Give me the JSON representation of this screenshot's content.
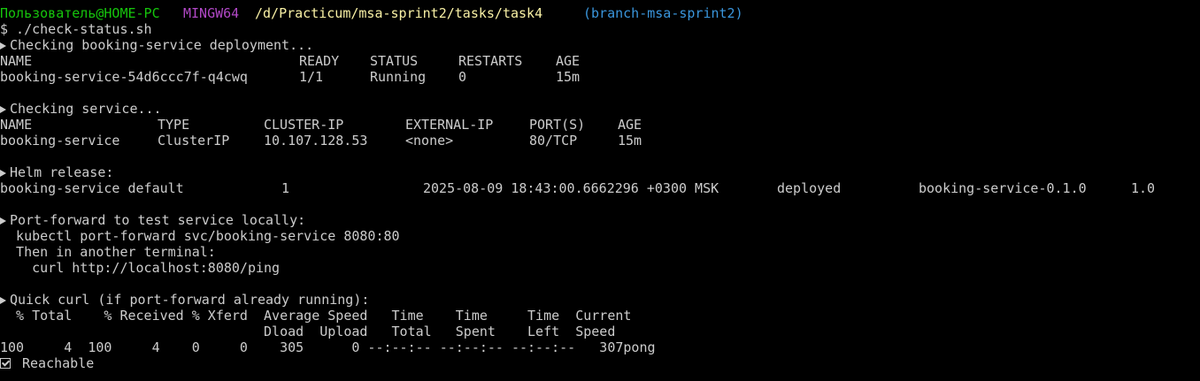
{
  "prompt": {
    "user_host": "Пользователь@HOME-PC",
    "env": "MINGW64",
    "path": "/d/Practicum/msa-sprint2/tasks/task4",
    "branch": "(branch-msa-sprint2)"
  },
  "command": "$ ./check-status.sh",
  "deployment": {
    "heading": "Checking booking-service deployment...",
    "headers": [
      "NAME",
      "READY",
      "STATUS",
      "RESTARTS",
      "AGE"
    ],
    "row": [
      "booking-service-54d6ccc7f-q4cwq",
      "1/1",
      "Running",
      "0",
      "15m"
    ]
  },
  "service": {
    "heading": "Checking service...",
    "headers": [
      "NAME",
      "TYPE",
      "CLUSTER-IP",
      "EXTERNAL-IP",
      "PORT(S)",
      "AGE"
    ],
    "row": [
      "booking-service",
      "ClusterIP",
      "10.107.128.53",
      "<none>",
      "80/TCP",
      "15m"
    ]
  },
  "helm": {
    "heading": "Helm release:",
    "row": [
      "booking-service default",
      "1",
      "2025-08-09 18:43:00.6662296 +0300 MSK",
      "deployed",
      "booking-service-0.1.0",
      "1.0"
    ]
  },
  "port_forward": {
    "heading": "Port-forward to test service locally:",
    "line1": "  kubectl port-forward svc/booking-service 8080:80",
    "line2": "  Then in another terminal:",
    "line3": "    curl http://localhost:8080/ping"
  },
  "quick_curl": {
    "heading": "Quick curl (if port-forward already running):",
    "header1": "  % Total    % Received % Xferd  Average Speed   Time    Time     Time  Current",
    "header2": "                                 Dload  Upload   Total   Spent    Left  Speed",
    "row": "100     4  100     4    0     0    305      0 --:--:-- --:--:-- --:--:--   307pong"
  },
  "result": {
    "icon": "check-box-icon",
    "text": "Reachable"
  },
  "icons": {
    "section_marker": "arrow-right-icon"
  },
  "colors": {
    "background": "#000000",
    "text": "#cccccc",
    "user_host": "#16c60c",
    "env": "#b148c6",
    "path": "#f9f1a5",
    "branch": "#3a96dd"
  }
}
